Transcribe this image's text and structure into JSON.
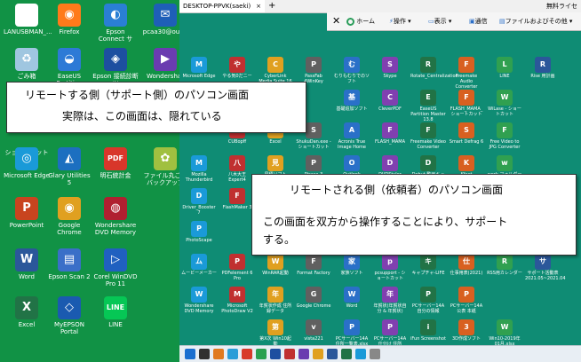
{
  "local_desktop": {
    "icons": [
      {
        "label": "LANUSBMAN_...",
        "color": "#ffffff",
        "glyph": "▭"
      },
      {
        "label": "Firefox",
        "color": "#ff7a1a",
        "glyph": "◉"
      },
      {
        "label": "Epson Connect サ",
        "color": "#2a7fd4",
        "glyph": "◐"
      },
      {
        "label": "pcaa30@outlo",
        "color": "#1e5fb8",
        "glyph": "✉"
      },
      {
        "label": "ごみ箱",
        "color": "#9fc6e0",
        "glyph": "♻"
      },
      {
        "label": "EaseUS Partition",
        "color": "#2d7ad6",
        "glyph": "◒"
      },
      {
        "label": "Epson 接続診断ツ",
        "color": "#1d4fa0",
        "glyph": "◈"
      },
      {
        "label": "Wondershar",
        "color": "#6a3cb0",
        "glyph": "▶"
      },
      {
        "label": "ショートカット",
        "color": "#119245",
        "glyph": ""
      },
      {
        "label": "Microsoft Edge",
        "color": "#1a9ad8",
        "glyph": "◎"
      },
      {
        "label": "Glary Utilities 5",
        "color": "#1c6fc0",
        "glyph": "◭"
      },
      {
        "label": "明石統計金",
        "color": "#d8362a",
        "glyph": "PDF"
      },
      {
        "label": "ファイル丸ごとバックアップ",
        "color": "#a0c040",
        "glyph": "✿"
      },
      {
        "label": "PowerPoint",
        "color": "#c8441f",
        "glyph": "P"
      },
      {
        "label": "Google Chrome",
        "color": "#e0a020",
        "glyph": "◉"
      },
      {
        "label": "Wondershare DVD Memory",
        "color": "#b02030",
        "glyph": "◍"
      },
      {
        "label": "Word",
        "color": "#2b579a",
        "glyph": "W"
      },
      {
        "label": "Epson Scan 2",
        "color": "#3a6fc8",
        "glyph": "▤"
      },
      {
        "label": "Corel WinDVD Pro 11",
        "color": "#2060c0",
        "glyph": "▷"
      },
      {
        "label": "Excel",
        "color": "#217346",
        "glyph": "X"
      },
      {
        "label": "MyEPSON Portal",
        "color": "#1a5ab0",
        "glyph": "◇"
      },
      {
        "label": "LINE",
        "color": "#06c755",
        "glyph": "LINE"
      }
    ]
  },
  "remote_window": {
    "tab_title": "DESKTOP-PPVK(saeki)",
    "tab_close": "×",
    "new_tab": "+",
    "top_right": "無料ライセ",
    "toolbar": {
      "close": "✕",
      "home": "ホーム",
      "operation": "操作",
      "display": "表示",
      "communication": "通信",
      "files": "ファイルおよびその他"
    },
    "icons": [
      "Microsoft Edge",
      "やる気0だニー",
      "CyberLink Media Suite 16",
      "PassFab 4WinKey",
      "むりもむりでのソフト",
      "Skype",
      "Rotate_Centralization",
      "Freemake Audio Converter",
      "LINE",
      "Rise 用計画",
      "",
      "",
      "",
      "",
      "基礎追加ソフト",
      "CleverPDF",
      "EaseUS Partition Master 13.8",
      "FLASH_MAMA_ショートカット",
      "WiLase - ショートカット",
      "",
      "",
      "CUBopff",
      "Excel",
      "ShukuDan.exe - ショートカット",
      "Acronis True Image Home",
      "FLASH_MAMA",
      "Freemake Video Converter",
      "Smart Defrag 6",
      "Free Video to JPG Converter",
      "",
      "Mozilla Thunderbird",
      "八木大王 Expert4",
      "見積ソフト",
      "Picasa 3",
      "Outlook",
      "DVDStyler",
      "Debut 動画キャプチャ",
      "Kfact Uninstaller",
      "work フォルダー",
      "",
      "Driver_Booster 7",
      "FlashMaker 3",
      "",
      "",
      "",
      "",
      "",
      "",
      "",
      "",
      "PhotoScape",
      "",
      "",
      "",
      "",
      "",
      "",
      "",
      "",
      "",
      "ムービーメーカー",
      "PDFelement 6 Pro",
      "WinRAR起動",
      "Format Factory",
      "家族ソフト",
      "pcsupport - ショートカット",
      "キャプチャ-LIFE",
      "仕事用表(2021)",
      "RSS用カレンダー",
      "サポート活動表 2021.05~2021.04",
      "Wondershare DVD Memory",
      "Microsoft PhotoDraw V2",
      "年賀状作成 住所録データ",
      "Google Chrome",
      "Word",
      "年賀状(年賀状自分 & 年賀状)",
      "PCサーバー14A 自分の情報",
      "PCサーバー14A 公表 本紙",
      "",
      "",
      "",
      "",
      "第X次 Win10起動",
      "vista221",
      "PCサーバー14A 住所一覧表.xlsx",
      "PCサーバー14A 仕分け 住所録.xlsx",
      "iFun Screenshot",
      "3D作成ソフト",
      "Win10-2019年01月.xlsx",
      "",
      "",
      ""
    ]
  },
  "callout_left": {
    "line1": "リモートする側（サポート側）のパソコン画面",
    "line2": "実際は、この画面は、隠れている"
  },
  "callout_right": {
    "line1": "リモートされる側（依頼者）のパソコン画面",
    "line2": "この画面を双方から操作することにより、サポート",
    "line3": "する。"
  }
}
